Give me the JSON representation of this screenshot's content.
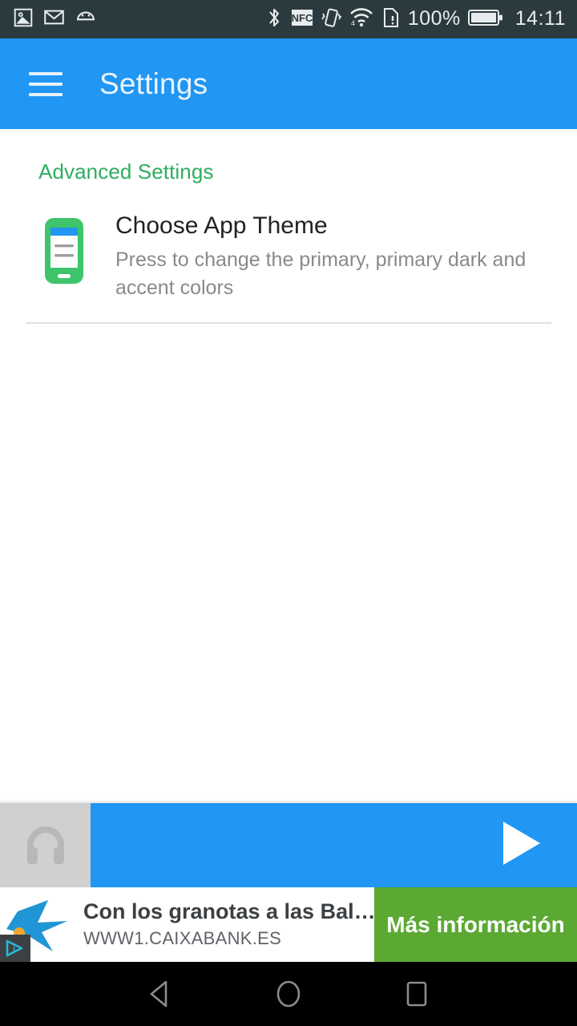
{
  "status_bar": {
    "left_icons": [
      {
        "name": "image-icon",
        "label": "Screenshot"
      },
      {
        "name": "mail-icon",
        "label": "Email"
      },
      {
        "name": "android-icon",
        "label": "Android"
      }
    ],
    "right_icons": [
      {
        "name": "bluetooth-icon",
        "label": "Bluetooth"
      },
      {
        "name": "nfc-icon",
        "label": "NFC"
      },
      {
        "name": "vibrate-icon",
        "label": "Vibrate"
      },
      {
        "name": "wifi-icon",
        "label": "Wi-Fi"
      },
      {
        "name": "sim-alert-icon",
        "label": "SIM alert"
      }
    ],
    "battery_percent": "100%",
    "time": "14:11",
    "background": "#2b3a3e",
    "foreground": "#e8eced"
  },
  "toolbar": {
    "menu_icon": "hamburger-icon",
    "title": "Settings",
    "background": "#2196f3",
    "title_color": "#e8f4fe"
  },
  "settings": {
    "category": "Advanced Settings",
    "category_color": "#2eae5f",
    "items": [
      {
        "icon": "phone-theme-icon",
        "title": "Choose App Theme",
        "summary": "Press to change the primary, primary dark and accent colors"
      }
    ]
  },
  "player": {
    "art_icon": "headphones-icon",
    "play_icon": "play-icon",
    "background": "#2196f3",
    "art_background": "#d0d0d0"
  },
  "ad": {
    "logo_icon": "caixabank-star-logo",
    "headline": "Con los granotas a las Bal…",
    "url": "WWW1.CAIXABANK.ES",
    "adchoices_icon": "adchoices-icon",
    "cta_label": "Más información",
    "cta_color": "#5ba933"
  },
  "navbar": {
    "buttons": [
      {
        "name": "back-button",
        "icon": "back-triangle-icon"
      },
      {
        "name": "home-button",
        "icon": "home-circle-icon"
      },
      {
        "name": "recents-button",
        "icon": "recents-square-icon"
      }
    ],
    "background": "#000000",
    "icon_color": "#8c8c8c"
  }
}
